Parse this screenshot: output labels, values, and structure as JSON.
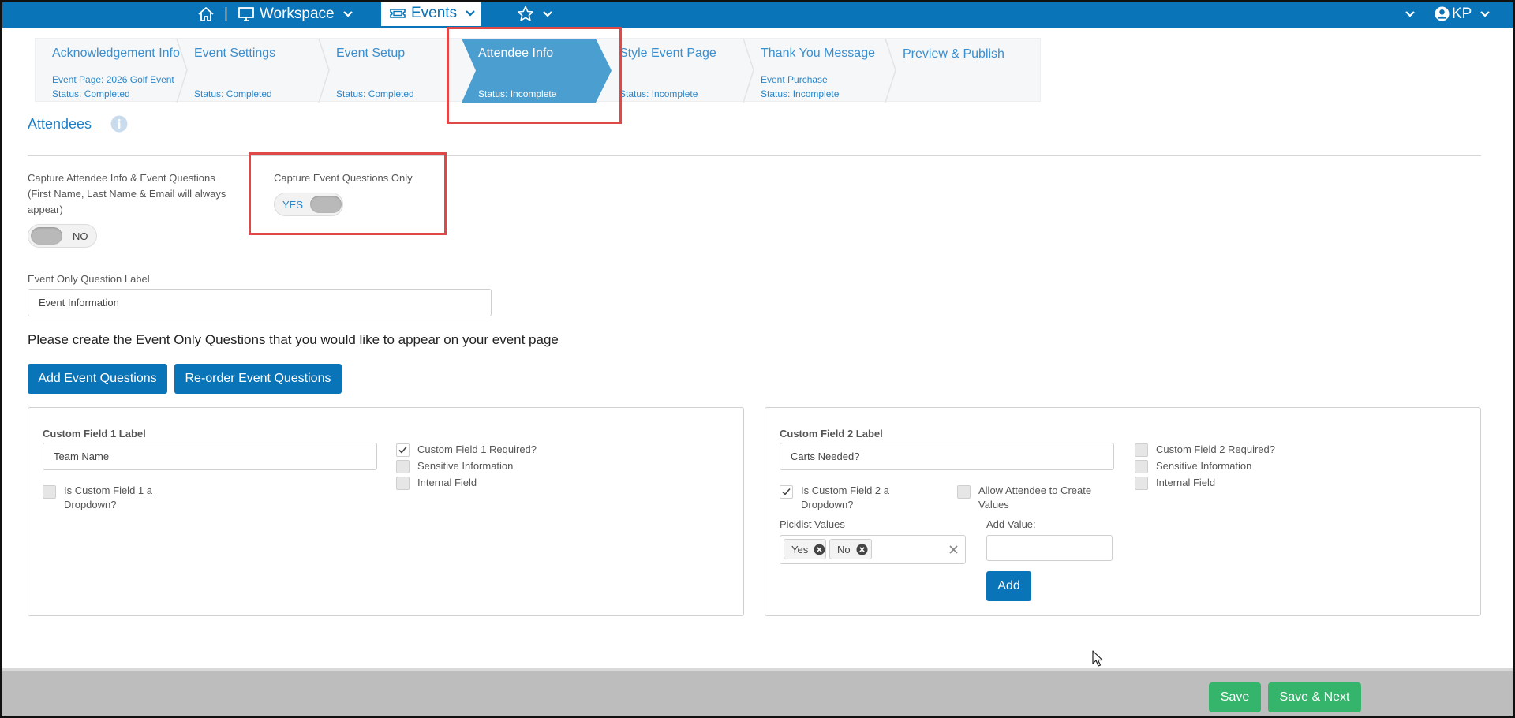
{
  "topbar": {
    "home_separator": "|",
    "workspace_label": "Workspace",
    "events_label": "Events",
    "user_initials": "KP",
    "icons": [
      "home-icon",
      "monitor-icon",
      "ticket-icon",
      "star-icon",
      "user-circle-icon",
      "chevron-down-icon"
    ],
    "color": "#0a74b8"
  },
  "steps": [
    {
      "title": "Acknowledgement Info",
      "line1": "Event Page: 2026 Golf Event",
      "line2": "Status: Completed"
    },
    {
      "title": "Event Settings",
      "line1": "",
      "line2": "Status: Completed"
    },
    {
      "title": "Event Setup",
      "line1": "",
      "line2": "Status: Completed"
    },
    {
      "title": "Attendee Info",
      "line1": "",
      "line2": "Status: Incomplete",
      "active": true
    },
    {
      "title": "Style Event Page",
      "line1": "",
      "line2": "Status: Incomplete"
    },
    {
      "title": "Thank You Message",
      "line1": "Event Purchase",
      "line2": "Status: Incomplete"
    },
    {
      "title": "Preview & Publish",
      "line1": "",
      "line2": ""
    }
  ],
  "section": {
    "title": "Attendees",
    "info_icon": "info-icon"
  },
  "capture_all": {
    "label_line1": "Capture Attendee Info & Event Questions",
    "label_line2": "(First Name, Last Name & Email will always",
    "label_line3": "appear)",
    "toggle_text": "NO"
  },
  "capture_event_only": {
    "label": "Capture Event Questions Only",
    "toggle_text": "YES"
  },
  "event_only_label": {
    "label": "Event Only Question Label",
    "value": "Event Information"
  },
  "prompt": "Please create the Event Only Questions that you would like to appear on your event page",
  "buttons": {
    "add_questions": "Add Event Questions",
    "reorder_questions": "Re-order Event Questions",
    "add": "Add",
    "save": "Save",
    "save_next": "Save & Next"
  },
  "field1": {
    "label": "Custom Field 1 Label",
    "value": "Team Name",
    "dropdown_q_line1": "Is Custom Field 1 a",
    "dropdown_q_line2": "Dropdown?",
    "required": "Custom Field 1 Required?",
    "sensitive": "Sensitive Information",
    "internal": "Internal Field",
    "required_checked": true,
    "dropdown_checked": false
  },
  "field2": {
    "label": "Custom Field 2 Label",
    "value": "Carts Needed?",
    "dropdown_q_line1": "Is Custom Field 2 a",
    "dropdown_q_line2": "Dropdown?",
    "allow_create_line1": "Allow Attendee to Create",
    "allow_create_line2": "Values",
    "picklist_label": "Picklist Values",
    "add_value_label": "Add Value:",
    "picklist_values": [
      "Yes",
      "No"
    ],
    "required": "Custom Field 2 Required?",
    "sensitive": "Sensitive Information",
    "internal": "Internal Field",
    "dropdown_checked": true
  },
  "colors": {
    "brand_blue": "#0a74b8",
    "save_green": "#35b46b",
    "highlight_red": "#e04848"
  }
}
